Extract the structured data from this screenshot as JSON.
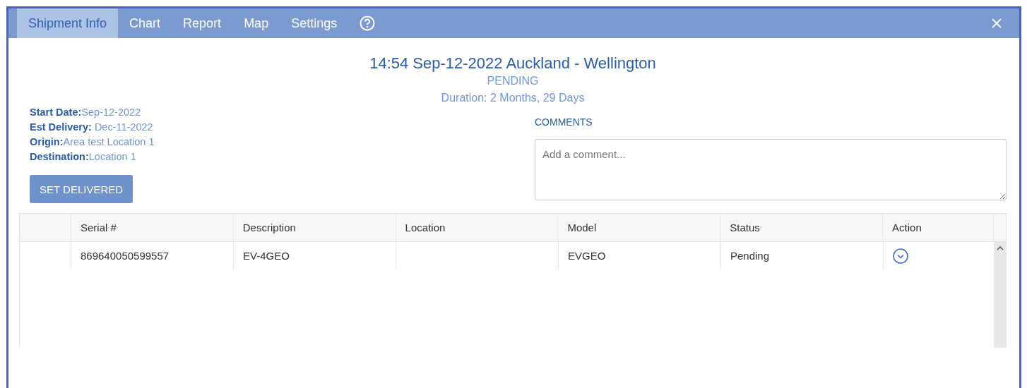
{
  "tabs": [
    {
      "label": "Shipment Info",
      "selected": true
    },
    {
      "label": "Chart",
      "selected": false
    },
    {
      "label": "Report",
      "selected": false
    },
    {
      "label": "Map",
      "selected": false
    },
    {
      "label": "Settings",
      "selected": false
    }
  ],
  "header": {
    "title": "14:54 Sep-12-2022 Auckland - Wellington",
    "status": "PENDING",
    "duration": "Duration: 2 Months, 29 Days"
  },
  "details": [
    {
      "label": "Start Date:",
      "value": "Sep-12-2022"
    },
    {
      "label": "Est Delivery:",
      "value": " Dec-11-2022"
    },
    {
      "label": "Origin:",
      "value": "Area test Location 1"
    },
    {
      "label": "Destination:",
      "value": "Location 1"
    }
  ],
  "action_button": "SET DELIVERED",
  "comments": {
    "label": "COMMENTS",
    "placeholder": "Add a comment..."
  },
  "table": {
    "columns": [
      "Serial #",
      "Description",
      "Location",
      "Model",
      "Status",
      "Action"
    ],
    "rows": [
      {
        "serial": "869640050599557",
        "description": "EV-4GEO",
        "model": "EVGEO",
        "status": "Pending"
      }
    ]
  }
}
